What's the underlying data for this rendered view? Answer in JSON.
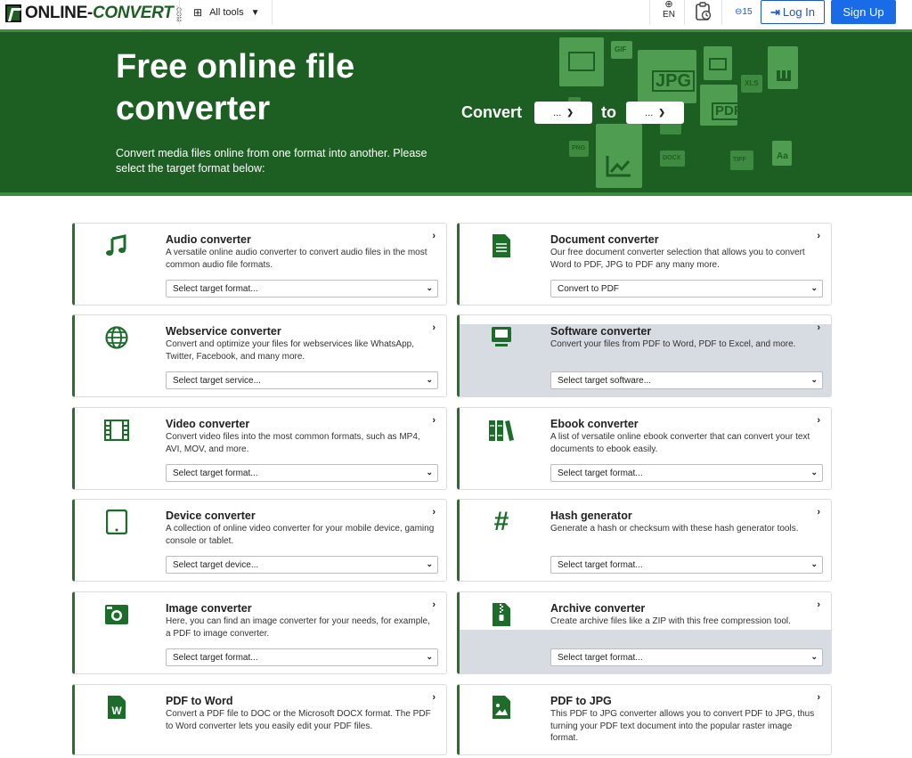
{
  "navbar": {
    "logo_main": "ONLINE-",
    "logo_conv": "CONVERT",
    "logo_com": ".COM",
    "all_tools": "All tools",
    "lang": "EN",
    "credits": "⊖15",
    "login": "Log In",
    "signup": "Sign Up"
  },
  "hero": {
    "title": "Free online file converter",
    "subtitle": "Convert media files online from one format into another. Please select the target format below:",
    "convert_label": "Convert",
    "to_label": "to",
    "from_select": "...",
    "to_select": "...",
    "file_labels": [
      "GIF",
      "JPG",
      "PDF",
      "XLS",
      "PNG",
      "DOCX",
      "TIFF",
      "Aa"
    ]
  },
  "cards": [
    {
      "title": "Audio converter",
      "desc": "A versatile online audio converter to convert audio files in the most common audio file formats.",
      "select": "Select target format...",
      "icon": "music-note-icon"
    },
    {
      "title": "Document converter",
      "desc": "Our free document converter selection that allows you to convert Word to PDF, JPG to PDF any many more.",
      "select": "Convert to PDF",
      "icon": "document-icon"
    },
    {
      "title": "Webservice converter",
      "desc": "Convert and optimize your files for webservices like WhatsApp, Twitter, Facebook, and many more.",
      "select": "Select target service...",
      "icon": "globe-icon"
    },
    {
      "title": "Software converter",
      "desc": "Convert your files from PDF to Word, PDF to Excel, and more.",
      "select": "Select target software...",
      "icon": "computer-icon"
    },
    {
      "title": "Video converter",
      "desc": "Convert video files into the most common formats, such as MP4, AVI, MOV, and more.",
      "select": "Select target format...",
      "icon": "film-icon"
    },
    {
      "title": "Ebook converter",
      "desc": "A list of versatile online ebook converter that can convert your text documents to ebook easily.",
      "select": "Select target format...",
      "icon": "books-icon"
    },
    {
      "title": "Device converter",
      "desc": "A collection of online video converter for your mobile device, gaming console or tablet.",
      "select": "Select target device...",
      "icon": "tablet-icon"
    },
    {
      "title": "Hash generator",
      "desc": "Generate a hash or checksum with these hash generator tools.",
      "select": "Select target format...",
      "icon": "hash-icon"
    },
    {
      "title": "Image converter",
      "desc": "Here, you can find an image converter for your needs, for example, a PDF to image converter.",
      "select": "Select target format...",
      "icon": "camera-icon"
    },
    {
      "title": "Archive converter",
      "desc": "Create archive files like a ZIP with this free compression tool.",
      "select": "Select target format...",
      "icon": "zip-file-icon"
    },
    {
      "title": "PDF to Word",
      "desc": "Convert a PDF file to DOC or the Microsoft DOCX format. The PDF to Word converter lets you easily edit your PDF files.",
      "icon": "word-file-icon"
    },
    {
      "title": "PDF to JPG",
      "desc": "This PDF to JPG converter allows you to convert PDF to JPG, thus turning your PDF text document into the popular raster image format.",
      "icon": "image-file-icon"
    }
  ]
}
